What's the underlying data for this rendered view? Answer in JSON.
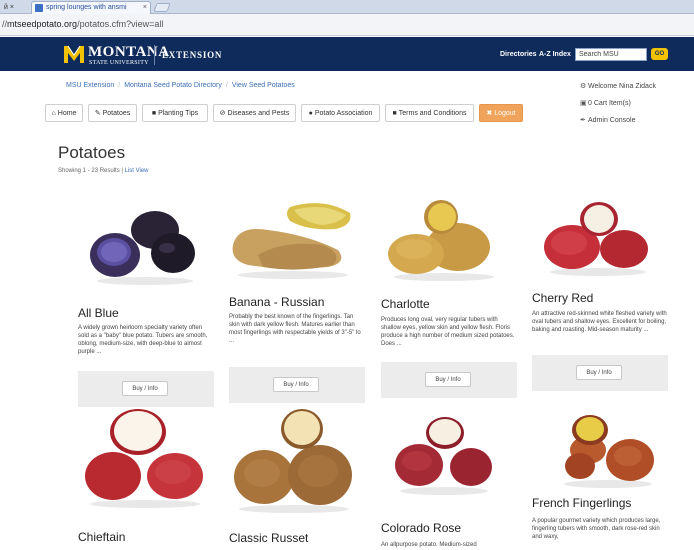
{
  "browser": {
    "prev_tab_label": "й ×",
    "tab_title": "spring lounges with ansmi",
    "tab_close": "×",
    "url_prefix": "//",
    "url_host": "mtseedpotato.org",
    "url_path": "/potatos.cfm?view=all"
  },
  "header": {
    "logo_name": "MONTANA",
    "logo_sub": "STATE UNIVERSITY",
    "logo_ext": "EXTENSION",
    "links": [
      "Directories",
      "A-Z Index"
    ],
    "search_value": "Search MSU",
    "go_label": "GO",
    "brand_color": "#0f2b5b",
    "accent_color": "#f2c200"
  },
  "breadcrumb": {
    "items": [
      "MSU Extension",
      "Montana Seed Potato Directory",
      "View Seed Potatoes"
    ],
    "separator": "/"
  },
  "user_menu": {
    "welcome": "Welcome Nina Zidack",
    "cart": "0 Cart Item(s)",
    "admin": "Admin Console",
    "icons": [
      "gear-icon",
      "cart-icon",
      "wrench-icon"
    ]
  },
  "nav": {
    "items": [
      {
        "icon": "⌂",
        "label": "Home"
      },
      {
        "icon": "✎",
        "label": "Potatoes"
      },
      {
        "icon": "■",
        "label": "Planting Tips"
      },
      {
        "icon": "⊘",
        "label": "Diseases and Pests"
      },
      {
        "icon": "●",
        "label": "Potato Association"
      },
      {
        "icon": "■",
        "label": "Terms and Conditions"
      },
      {
        "icon": "✖",
        "label": "Logout"
      }
    ],
    "logout_color": "#f0a35a"
  },
  "page": {
    "title": "Potatoes",
    "results_text": "Showing 1 - 23 Results |",
    "list_view": "List View"
  },
  "products": [
    {
      "name": "All Blue",
      "desc": "A widely grown heirloom specialty variety often sold as a \"baby\" blue potato. Tubers are smooth, oblong, medium-size, with deep-blue to almost purple ...",
      "buy": "Buy / Info"
    },
    {
      "name": "Banana - Russian",
      "desc": "Probably the best known of the fingerlings. Tan skin with dark yellow flesh. Matures earlier than most fingerlings with respectable yields of 3\"-5\" lo ...",
      "buy": "Buy / Info"
    },
    {
      "name": "Charlotte",
      "desc": "Produces long oval, very regular tubers with shallow eyes, yellow skin and yellow flesh. Floris produce a high number of medium sized potatoes. Does ...",
      "buy": "Buy / Info"
    },
    {
      "name": "Cherry Red",
      "desc": "An attractive red-skinned white fleshed variety with oval tubers and shallow eyes. Excellent for boiling, baking and roasting. Mid-season maturity ...",
      "buy": "Buy / Info"
    },
    {
      "name": "Chieftain",
      "desc": "",
      "buy": ""
    },
    {
      "name": "Classic Russet",
      "desc": "",
      "buy": ""
    },
    {
      "name": "Colorado Rose",
      "desc": "An allpurpose potato. Medium-sized",
      "buy": ""
    },
    {
      "name": "French Fingerlings",
      "desc": "A popular gourmet variety which produces large, fingerling tubers with smooth, dark rose-red skin and waxy,",
      "buy": ""
    }
  ]
}
